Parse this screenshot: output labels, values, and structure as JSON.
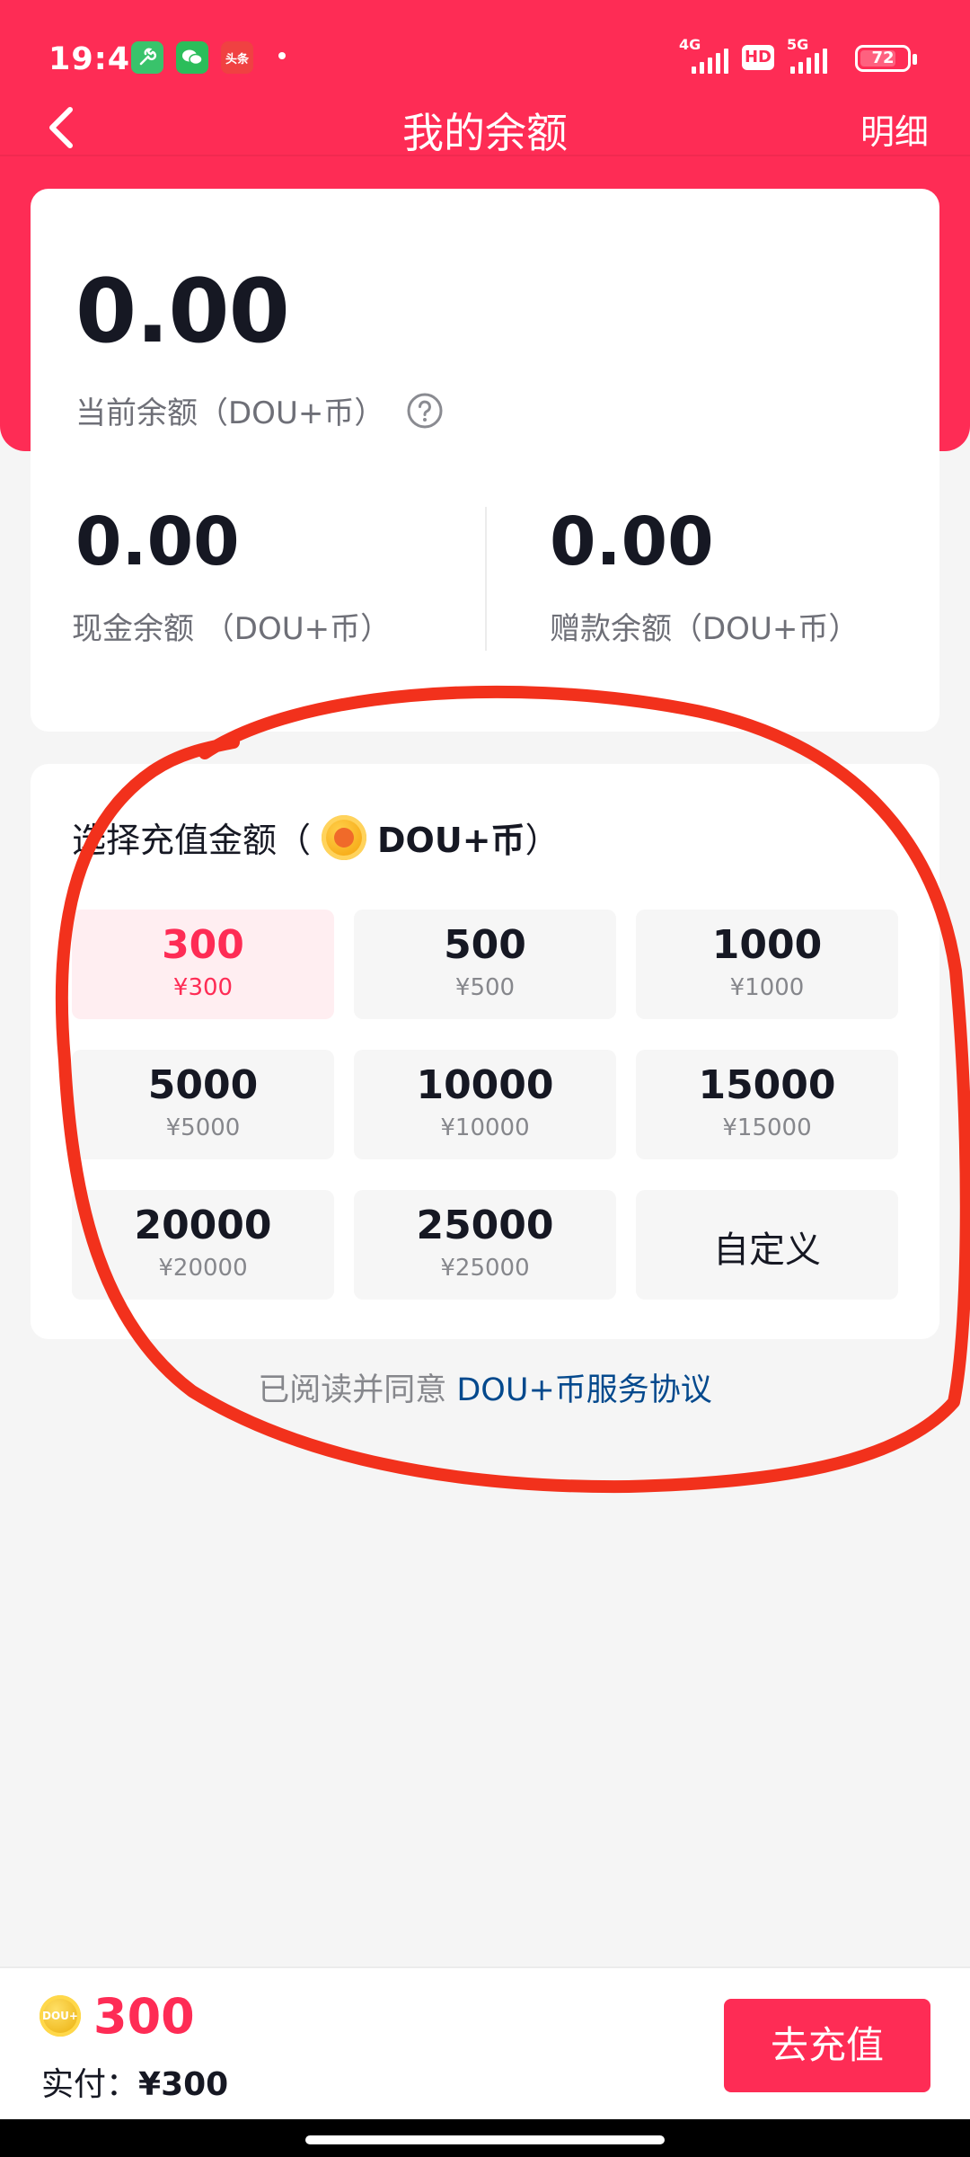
{
  "status_bar": {
    "time": "19:47",
    "app_icons": [
      "tool-app-icon",
      "wechat-icon",
      "toutiao-icon"
    ],
    "toutiao_label": "头条",
    "network_1": "4G",
    "network_2": "5G",
    "hd": "HD",
    "battery": "72"
  },
  "nav": {
    "title": "我的余额",
    "detail": "明细",
    "back_icon": "chevron-left-icon"
  },
  "balance": {
    "current_amount": "0.00",
    "current_label": "当前余额（DOU+币）",
    "cash_amount": "0.00",
    "cash_label": "现金余额 （DOU+币）",
    "bonus_amount": "0.00",
    "bonus_label": "赠款余额（DOU+币）"
  },
  "recharge": {
    "title_prefix": "选择充值金额（",
    "title_coin": "DOU+币",
    "title_suffix": "）",
    "options": [
      {
        "value": "300",
        "price": "¥300",
        "selected": true
      },
      {
        "value": "500",
        "price": "¥500"
      },
      {
        "value": "1000",
        "price": "¥1000"
      },
      {
        "value": "5000",
        "price": "¥5000"
      },
      {
        "value": "10000",
        "price": "¥10000"
      },
      {
        "value": "15000",
        "price": "¥15000"
      },
      {
        "value": "20000",
        "price": "¥20000"
      },
      {
        "value": "25000",
        "price": "¥25000"
      }
    ],
    "custom_label": "自定义"
  },
  "agreement": {
    "prefix": "已阅读并同意 ",
    "link": "DOU+币服务协议"
  },
  "bottom": {
    "coin_text": "DOU+",
    "amount": "300",
    "paid_label": "实付：",
    "paid_amount": "¥300",
    "pay_button": "去充值"
  },
  "colors": {
    "brand": "#fe2c55",
    "link": "#04498d",
    "annotation": "#f2311c"
  }
}
